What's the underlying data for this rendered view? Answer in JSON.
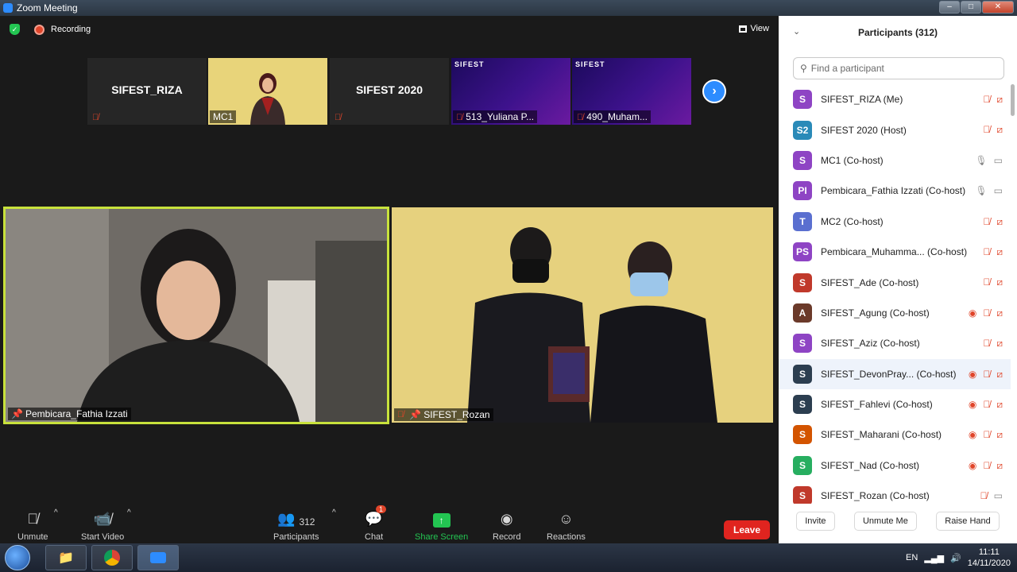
{
  "window": {
    "title": "Zoom Meeting",
    "buttons": [
      "–",
      "□",
      "✕"
    ]
  },
  "topbar": {
    "recording_label": "Recording",
    "view_label": "View"
  },
  "gallery_strip": [
    {
      "name": "SIFEST_RIZA",
      "caption": "",
      "type": "name"
    },
    {
      "name": "",
      "caption": "MC1",
      "type": "video-yellow"
    },
    {
      "name": "SIFEST 2020",
      "caption": "",
      "type": "name"
    },
    {
      "name": "",
      "caption": "513_Yuliana P...",
      "type": "video-purple",
      "banner": "SIFEST"
    },
    {
      "name": "",
      "caption": "490_Muham...",
      "type": "video-purple",
      "banner": "SIFEST"
    }
  ],
  "speakers": {
    "left": {
      "name": "Pembicara_Fathia Izzati"
    },
    "right": {
      "name": "SIFEST_Rozan"
    }
  },
  "toolbar": {
    "unmute": "Unmute",
    "start_video": "Start Video",
    "participants_label": "Participants",
    "participants_count": "312",
    "chat": "Chat",
    "chat_badge": "1",
    "share_screen": "Share Screen",
    "record": "Record",
    "reactions": "Reactions",
    "leave": "Leave"
  },
  "panel": {
    "title": "Participants (312)",
    "search_placeholder": "Find a participant",
    "participants": [
      {
        "initials": "S",
        "color": "#8e44c4",
        "name": "SIFEST_RIZA (Me)",
        "mic": "off",
        "cam": "off",
        "rec": false
      },
      {
        "initials": "S2",
        "color": "#2a8ab8",
        "name": "SIFEST 2020 (Host)",
        "mic": "off",
        "cam": "off",
        "rec": false
      },
      {
        "initials": "S",
        "color": "#8e44c4",
        "name": "MC1 (Co-host)",
        "mic": "on",
        "cam": "on",
        "rec": false
      },
      {
        "initials": "PI",
        "color": "#8e44c4",
        "name": "Pembicara_Fathia Izzati (Co-host)",
        "mic": "on",
        "cam": "on",
        "rec": false
      },
      {
        "initials": "T",
        "color": "#5a6fd0",
        "name": "MC2 (Co-host)",
        "mic": "off",
        "cam": "off",
        "rec": false
      },
      {
        "initials": "PS",
        "color": "#8e44c4",
        "name": "Pembicara_Muhamma... (Co-host)",
        "mic": "off",
        "cam": "off",
        "rec": false
      },
      {
        "initials": "S",
        "color": "#c0392b",
        "name": "SIFEST_Ade (Co-host)",
        "mic": "off",
        "cam": "off",
        "rec": false
      },
      {
        "initials": "A",
        "color": "#6b3a2a",
        "name": "SIFEST_Agung (Co-host)",
        "mic": "off",
        "cam": "off",
        "rec": true
      },
      {
        "initials": "S",
        "color": "#8e44c4",
        "name": "SIFEST_Aziz (Co-host)",
        "mic": "off",
        "cam": "off",
        "rec": false
      },
      {
        "initials": "S",
        "color": "#2c3e50",
        "name": "SIFEST_DevonPray... (Co-host)",
        "mic": "off",
        "cam": "off",
        "rec": true
      },
      {
        "initials": "S",
        "color": "#2c3e50",
        "name": "SIFEST_Fahlevi (Co-host)",
        "mic": "off",
        "cam": "off",
        "rec": true
      },
      {
        "initials": "S",
        "color": "#d35400",
        "name": "SIFEST_Maharani (Co-host)",
        "mic": "off",
        "cam": "off",
        "rec": true
      },
      {
        "initials": "S",
        "color": "#27ae60",
        "name": "SIFEST_Nad (Co-host)",
        "mic": "off",
        "cam": "off",
        "rec": true
      },
      {
        "initials": "S",
        "color": "#c0392b",
        "name": "SIFEST_Rozan (Co-host)",
        "mic": "off",
        "cam": "on",
        "rec": false
      }
    ],
    "footer": {
      "invite": "Invite",
      "unmute_me": "Unmute Me",
      "raise_hand": "Raise Hand"
    }
  },
  "taskbar": {
    "lang": "EN",
    "time": "11:11",
    "date": "14/11/2020"
  }
}
